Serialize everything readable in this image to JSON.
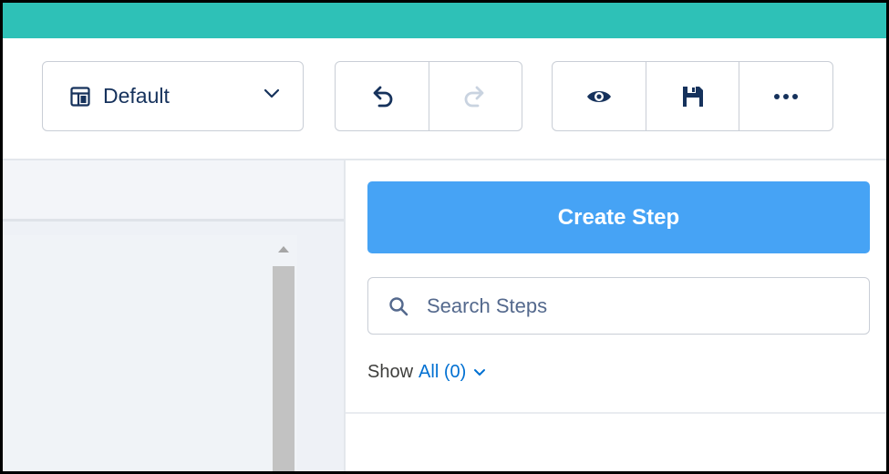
{
  "toolbar": {
    "layout_label": "Default",
    "undo_icon": "undo-icon",
    "redo_icon": "redo-icon",
    "preview_icon": "eye-icon",
    "save_icon": "save-icon",
    "more_icon": "more-icon"
  },
  "panel": {
    "create_label": "Create Step",
    "search_placeholder": "Search Steps",
    "show_label": "Show",
    "show_filter": "All (0)"
  },
  "colors": {
    "header": "#2ec1b7",
    "accent": "#46a3f5",
    "link": "#0070d2"
  }
}
